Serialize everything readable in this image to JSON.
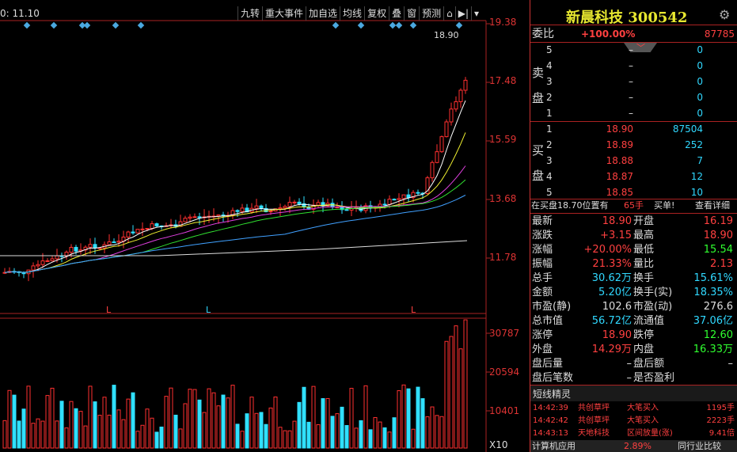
{
  "toolbar": {
    "time_label": "0: 11.10",
    "buttons": [
      "九转",
      "重大事件",
      "加自选",
      "均线",
      "复权",
      "叠",
      "窗",
      "预测"
    ]
  },
  "price_axis": [
    "19.38",
    "17.48",
    "15.59",
    "13.68",
    "11.78"
  ],
  "volume_axis": [
    "30787",
    "20594",
    "10401"
  ],
  "volume_unit": "X10",
  "high_label": "18.90",
  "low_markers": [
    "L",
    "L",
    "L"
  ],
  "stock": {
    "name": "新晨科技",
    "code": "300542"
  },
  "webi": {
    "label": "委比",
    "pct": "+100.00%",
    "value": "87785"
  },
  "sell_title": [
    "卖",
    "盘"
  ],
  "buy_title": [
    "买",
    "盘"
  ],
  "sell": [
    {
      "level": "5",
      "price": "–",
      "vol": "0"
    },
    {
      "level": "4",
      "price": "–",
      "vol": "0"
    },
    {
      "level": "3",
      "price": "–",
      "vol": "0"
    },
    {
      "level": "2",
      "price": "–",
      "vol": "0"
    },
    {
      "level": "1",
      "price": "–",
      "vol": "0"
    }
  ],
  "buy": [
    {
      "level": "1",
      "price": "18.90",
      "vol": "87504"
    },
    {
      "level": "2",
      "price": "18.89",
      "vol": "252"
    },
    {
      "level": "3",
      "price": "18.88",
      "vol": "7"
    },
    {
      "level": "4",
      "price": "18.87",
      "vol": "12"
    },
    {
      "level": "5",
      "price": "18.85",
      "vol": "10"
    }
  ],
  "order_info": {
    "text": "在买盘18.70位置有",
    "qty": "65手",
    "action": "买单!",
    "detail": "查看详细"
  },
  "stats": [
    {
      "l1": "最新",
      "v1": "18.90",
      "c1": "red",
      "l2": "开盘",
      "v2": "16.19",
      "c2": "red"
    },
    {
      "l1": "涨跌",
      "v1": "+3.15",
      "c1": "red",
      "l2": "最高",
      "v2": "18.90",
      "c2": "red"
    },
    {
      "l1": "涨幅",
      "v1": "+20.00%",
      "c1": "red",
      "l2": "最低",
      "v2": "15.54",
      "c2": "grn"
    },
    {
      "l1": "振幅",
      "v1": "21.33%",
      "c1": "red",
      "l2": "量比",
      "v2": "2.13",
      "c2": "red"
    },
    {
      "l1": "总手",
      "v1": "30.62万",
      "c1": "cyan",
      "l2": "换手",
      "v2": "15.61%",
      "c2": "cyan"
    },
    {
      "l1": "金额",
      "v1": "5.20亿",
      "c1": "cyan",
      "l2": "换手(实)",
      "v2": "18.35%",
      "c2": "cyan"
    },
    {
      "l1": "市盈(静)",
      "v1": "102.6",
      "c1": "wht",
      "l2": "市盈(动)",
      "v2": "276.6",
      "c2": "wht"
    },
    {
      "l1": "总市值",
      "v1": "56.72亿",
      "c1": "cyan",
      "l2": "流通值",
      "v2": "37.06亿",
      "c2": "cyan"
    },
    {
      "l1": "涨停",
      "v1": "18.90",
      "c1": "red",
      "l2": "跌停",
      "v2": "12.60",
      "c2": "grn"
    },
    {
      "l1": "外盘",
      "v1": "14.29万",
      "c1": "red",
      "l2": "内盘",
      "v2": "16.33万",
      "c2": "grn"
    },
    {
      "l1": "盘后量",
      "v1": "–",
      "c1": "wht",
      "l2": "盘后额",
      "v2": "–",
      "c2": "wht"
    },
    {
      "l1": "盘后笔数",
      "v1": "–",
      "c1": "wht",
      "l2": "是否盈利",
      "v2": "",
      "c2": "wht"
    }
  ],
  "elves": {
    "title": "短线精灵",
    "items": [
      {
        "time": "14:42:39",
        "name": "共创草坪",
        "event": "大笔买入",
        "val": "1195手"
      },
      {
        "time": "14:42:42",
        "name": "共创草坪",
        "event": "大笔买入",
        "val": "2223手"
      },
      {
        "time": "14:43:13",
        "name": "天地科技",
        "event": "区间放量(涨)",
        "val": "9.41倍"
      }
    ]
  },
  "footer": {
    "left": "计算机应用",
    "mid": "2.89%",
    "right": "同行业比较"
  }
}
